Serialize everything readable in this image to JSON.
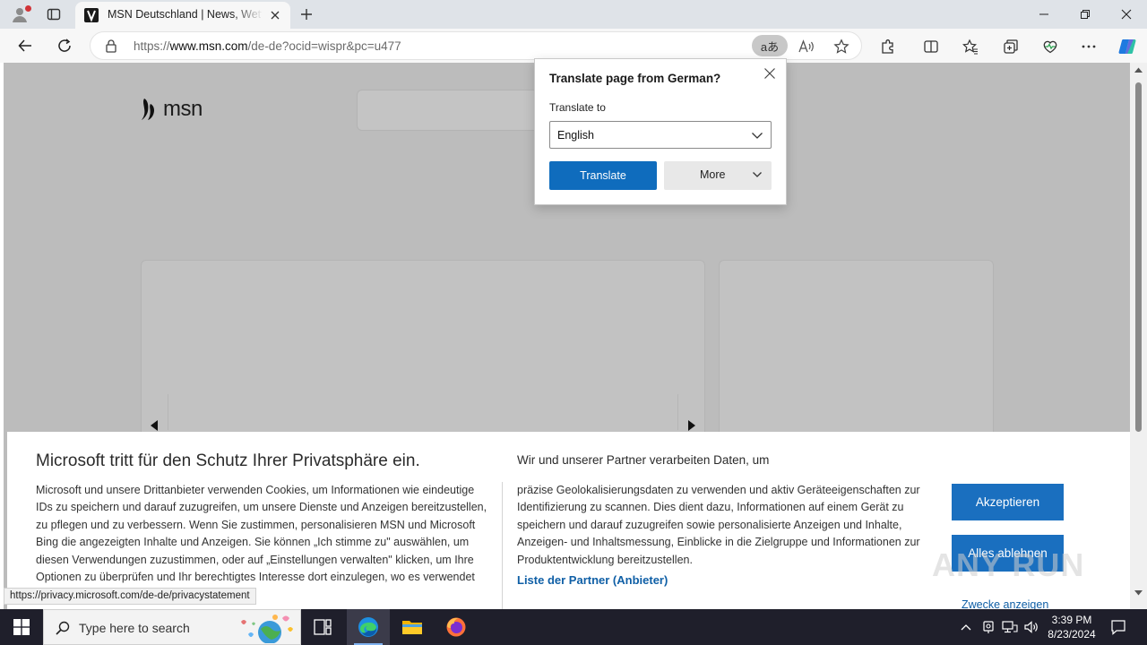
{
  "browser": {
    "tab": {
      "title": "MSN Deutschland | News, Wetter, Sport"
    },
    "address": {
      "url_prefix": "https://",
      "url_host": "www.msn.com",
      "url_path": "/de-de?ocid=wispr&pc=u477"
    },
    "translate_indicator": "aあ",
    "read_aloud": "Ã"
  },
  "translate_popup": {
    "title": "Translate page from German?",
    "label": "Translate to",
    "selected_language": "English",
    "translate_button": "Translate",
    "more_button": "More"
  },
  "page": {
    "logo": "msn"
  },
  "consent": {
    "title": "Microsoft tritt für den Schutz Ihrer Privatsphäre ein.",
    "body": "Microsoft und unsere Drittanbieter verwenden Cookies, um Informationen wie eindeutige IDs zu speichern und darauf zuzugreifen, um unsere Dienste und Anzeigen bereitzustellen, zu pflegen und zu verbessern. Wenn Sie zustimmen, personalisieren MSN und Microsoft Bing die angezeigten Inhalte und Anzeigen. Sie können „Ich stimme zu\" auswählen, um diesen Verwendungen zuzustimmen, oder auf „Einstellungen verwalten\" klicken, um Ihre Optionen zu überprüfen und Ihr berechtigtes Interesse dort einzulegen, wo es verwendet",
    "partner_heading": "Wir und unserer Partner verarbeiten Daten, um",
    "partner_body": "präzise Geolokalisierungsdaten zu verwenden und aktiv Geräteeigenschaften zur Identifizierung zu scannen. Dies dient dazu, Informationen auf einem Gerät zu speichern und darauf zuzugreifen sowie personalisierte Anzeigen und Inhalte, Anzeigen- und Inhaltsmessung, Einblicke in die Zielgruppe und Informationen zur Produktentwicklung bereitzustellen.",
    "partner_link": "Liste der Partner (Anbieter)",
    "accept_button": "Akzeptieren",
    "reject_button": "Alles ablehnen",
    "purposes_link": "Zwecke anzeigen"
  },
  "status_bar": {
    "url": "https://privacy.microsoft.com/de-de/privacystatement"
  },
  "watermark": "ANY RUN",
  "taskbar": {
    "search_placeholder": "Type here to search",
    "time": "3:39 PM",
    "date": "8/23/2024"
  },
  "colors": {
    "accent": "#0f6cbd",
    "consent_button": "#1a6fbf",
    "link": "#0f5fa6",
    "page_dim": "#bcbcbc",
    "taskbar": "#1f1f2b"
  }
}
